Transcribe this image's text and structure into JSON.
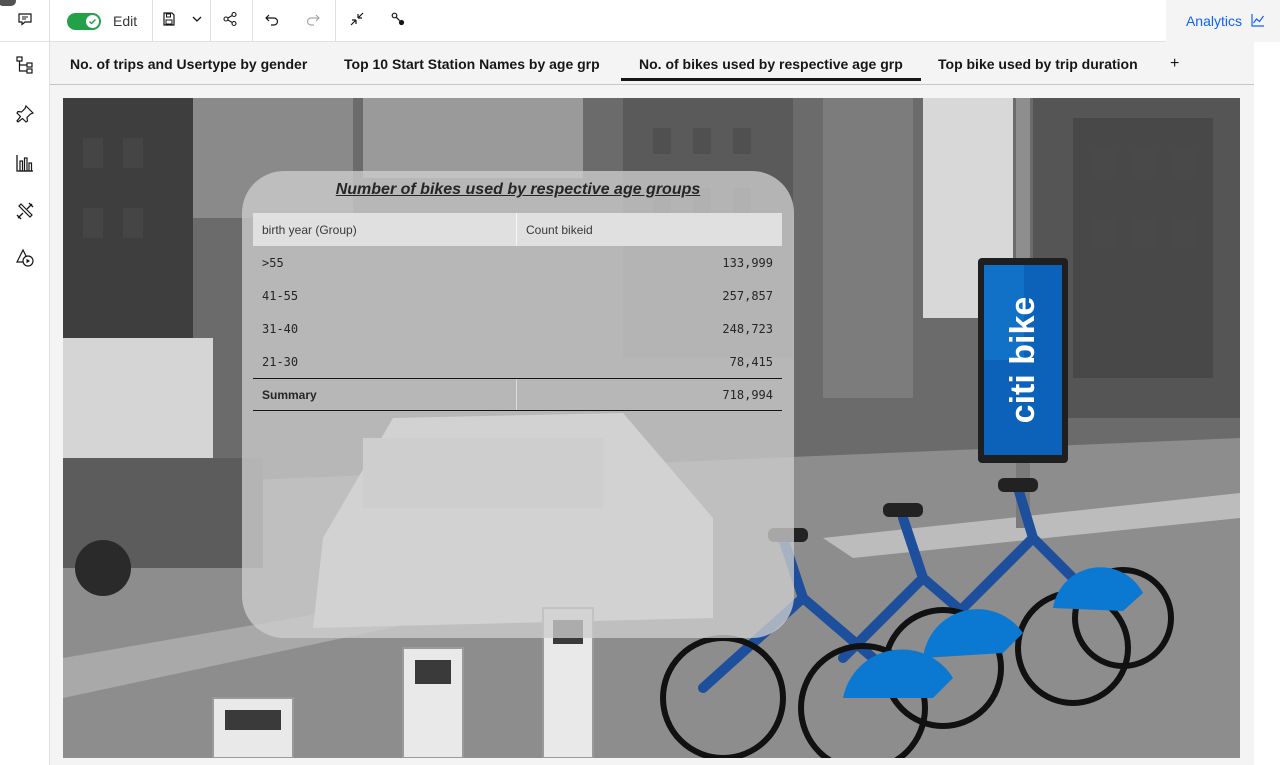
{
  "toolbar": {
    "edit_label": "Edit",
    "analytics_label": "Analytics",
    "icons": [
      "comment-icon",
      "save-icon",
      "chevron-down-icon",
      "share-icon",
      "undo-icon",
      "redo-icon",
      "collapse-icon",
      "connection-icon",
      "line-chart-icon"
    ]
  },
  "rail": {
    "icons": [
      "hierarchy-icon",
      "pin-icon",
      "bar-chart-icon",
      "tools-icon",
      "shapes-icon"
    ]
  },
  "tabs": [
    {
      "label": "No. of trips and Usertype by gender"
    },
    {
      "label": "Top 10 Start Station Names by age grp"
    },
    {
      "label": "No. of bikes used by respective age grp"
    },
    {
      "label": "Top bike used by trip duration"
    }
  ],
  "active_tab": 2,
  "tab_add_label": "+",
  "photo": {
    "kiosk_brand": "citi bike"
  },
  "widget": {
    "title": "Number of bikes used by respective age groups",
    "columns": [
      "birth year (Group)",
      "Count bikeid"
    ],
    "rows": [
      {
        "group": ">55",
        "count": "133,999"
      },
      {
        "group": "41-55",
        "count": "257,857"
      },
      {
        "group": "31-40",
        "count": "248,723"
      },
      {
        "group": "21-30",
        "count": "78,415"
      }
    ],
    "summary": {
      "label": "Summary",
      "count": "718,994"
    }
  },
  "colors": {
    "toggle_on": "#24a148",
    "accent": "#0f62fe",
    "citibike_blue": "#0b62b8"
  }
}
